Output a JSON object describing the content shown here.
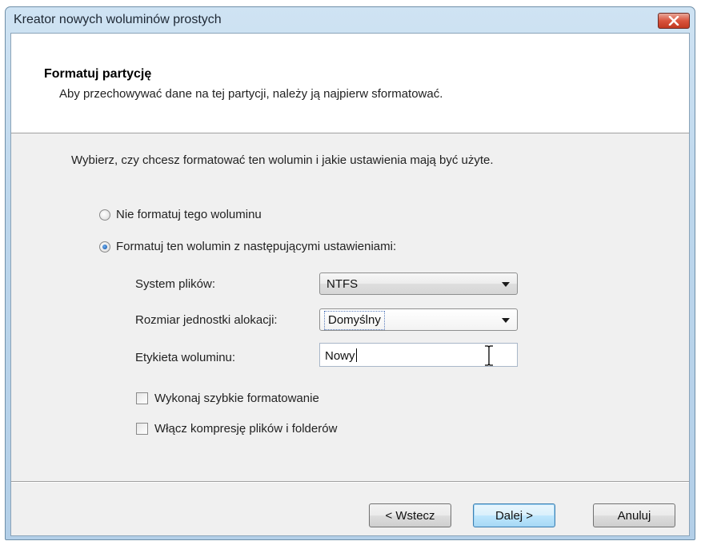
{
  "window": {
    "title": "Kreator nowych woluminów prostych"
  },
  "header": {
    "title": "Formatuj partycję",
    "subtitle": "Aby przechowywać dane na tej partycji, należy ją najpierw sformatować."
  },
  "instruction": "Wybierz, czy chcesz formatować ten wolumin i jakie ustawienia mają być użyte.",
  "options": {
    "no_format_label": "Nie formatuj tego woluminu",
    "no_format_selected": false,
    "format_label": "Formatuj ten wolumin z następującymi ustawieniami:",
    "format_selected": true
  },
  "fields": {
    "filesystem_label": "System plików:",
    "filesystem_value": "NTFS",
    "allocation_label": "Rozmiar jednostki alokacji:",
    "allocation_value": "Domyślny",
    "volume_label_label": "Etykieta woluminu:",
    "volume_label_value": "Nowy"
  },
  "checkboxes": {
    "quick_format_label": "Wykonaj szybkie formatowanie",
    "quick_format_checked": false,
    "compression_label": "Włącz kompresję plików i folderów",
    "compression_checked": false
  },
  "buttons": {
    "back_label": "< Wstecz",
    "next_label": "Dalej >",
    "cancel_label": "Anuluj"
  },
  "colors": {
    "close_button": "#d9533c",
    "default_button_border": "#3c7fb1",
    "radio_dot": "#1f5fb0"
  }
}
